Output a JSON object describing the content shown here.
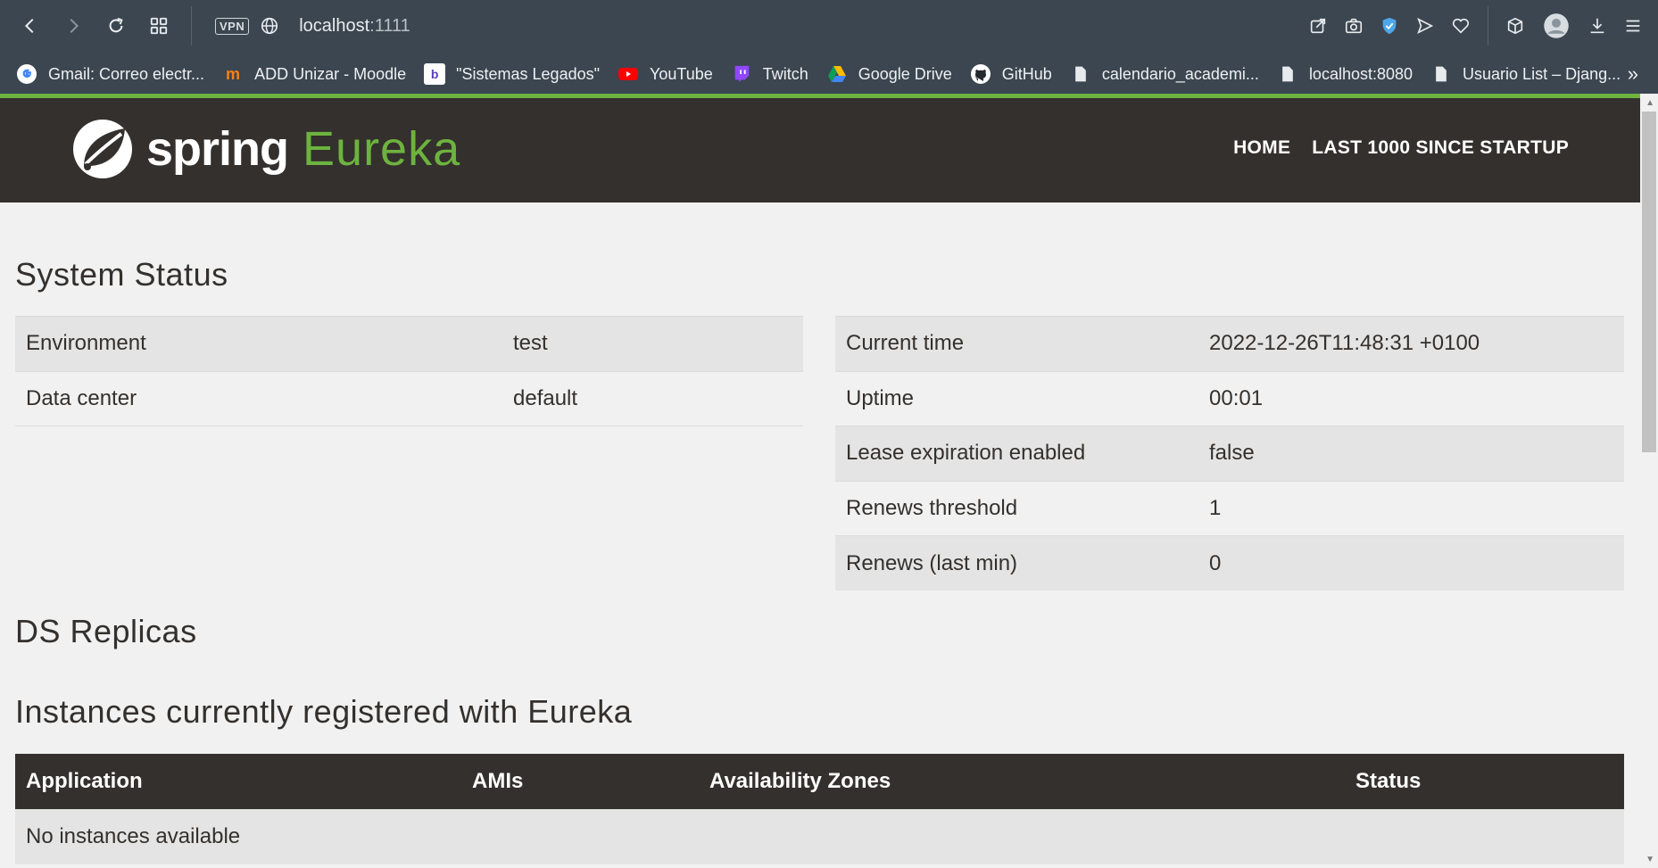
{
  "browser": {
    "url_host": "localhost",
    "url_port": ":1111",
    "vpn_label": "VPN",
    "bookmarks": [
      {
        "label": "Gmail: Correo electr...",
        "icon": "google-icon"
      },
      {
        "label": "ADD Unizar - Moodle",
        "icon": "moodle-icon"
      },
      {
        "label": "\"Sistemas Legados\"",
        "icon": "bookmark-app-icon"
      },
      {
        "label": "YouTube",
        "icon": "youtube-icon"
      },
      {
        "label": "Twitch",
        "icon": "twitch-icon"
      },
      {
        "label": "Google Drive",
        "icon": "google-drive-icon"
      },
      {
        "label": "GitHub",
        "icon": "github-icon"
      },
      {
        "label": "calendario_academi...",
        "icon": "file-icon"
      },
      {
        "label": "localhost:8080",
        "icon": "file-icon"
      },
      {
        "label": "Usuario List – Djang...",
        "icon": "file-icon"
      }
    ],
    "more_label": "»"
  },
  "header": {
    "logo_spring": "spring",
    "logo_eureka": "Eureka",
    "nav": [
      "HOME",
      "LAST 1000 SINCE STARTUP"
    ]
  },
  "system_status": {
    "title": "System Status",
    "left": [
      {
        "key": "Environment",
        "value": "test"
      },
      {
        "key": "Data center",
        "value": "default"
      }
    ],
    "right": [
      {
        "key": "Current time",
        "value": "2022-12-26T11:48:31 +0100"
      },
      {
        "key": "Uptime",
        "value": "00:01"
      },
      {
        "key": "Lease expiration enabled",
        "value": "false"
      },
      {
        "key": "Renews threshold",
        "value": "1"
      },
      {
        "key": "Renews (last min)",
        "value": "0"
      }
    ]
  },
  "ds_replicas": {
    "title": "DS Replicas"
  },
  "instances": {
    "title": "Instances currently registered with Eureka",
    "columns": [
      "Application",
      "AMIs",
      "Availability Zones",
      "Status"
    ],
    "empty_message": "No instances available"
  },
  "colors": {
    "brand_green": "#6db33f",
    "header_dark": "#34302d",
    "browser_chrome": "#3b4650"
  }
}
